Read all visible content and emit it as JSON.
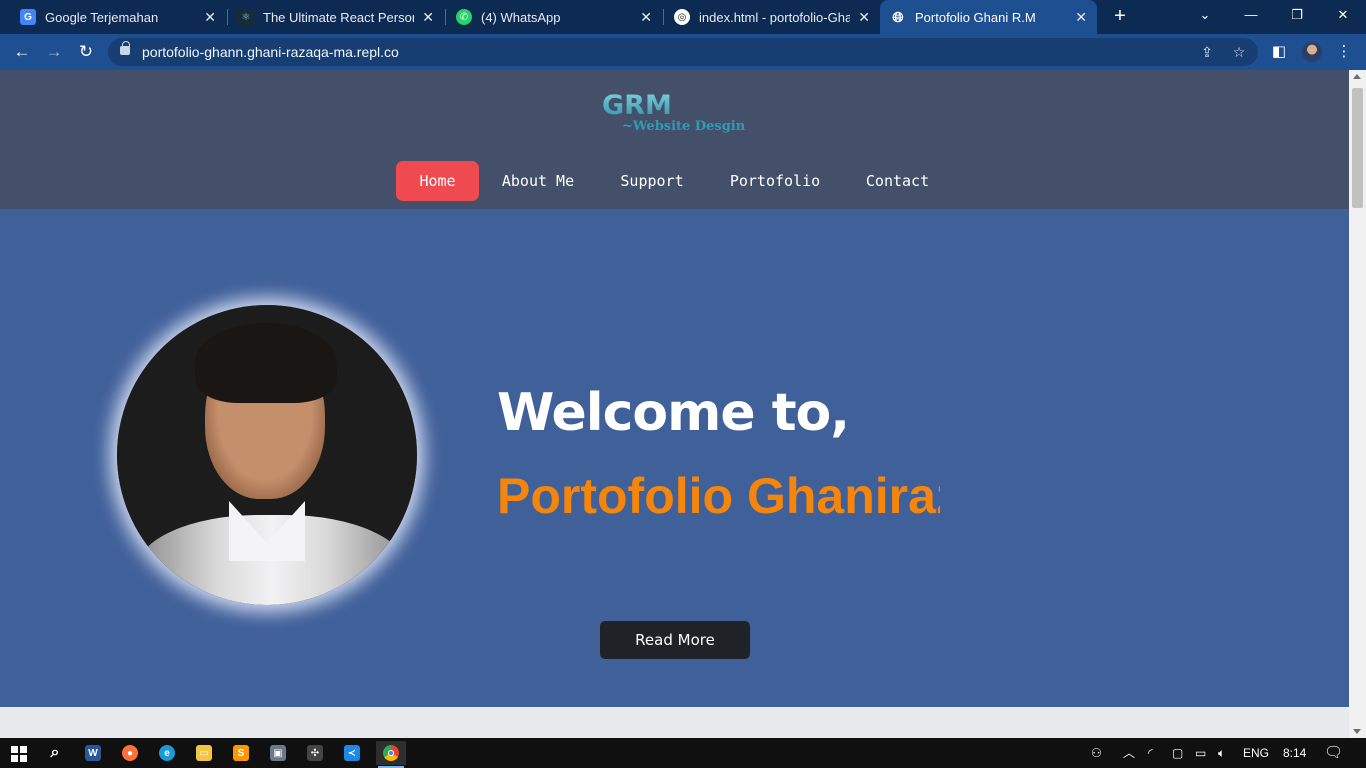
{
  "browser": {
    "tabs": [
      {
        "title": "Google Terjemahan",
        "icon": "google-translate-icon",
        "active": false
      },
      {
        "title": "The Ultimate React Personal P",
        "icon": "react-icon",
        "active": false
      },
      {
        "title": "(4) WhatsApp",
        "icon": "whatsapp-icon",
        "active": false
      },
      {
        "title": "index.html - portofolio-Ghan",
        "icon": "replit-icon",
        "active": false
      },
      {
        "title": "Portofolio Ghani R.M",
        "icon": "globe-icon",
        "active": true
      }
    ],
    "new_tab_icon": "+",
    "url": "portofolio-ghann.ghani-razaqa-ma.repl.co"
  },
  "site": {
    "logo": {
      "text": "GRM",
      "tagline": "~Website Desgin"
    },
    "nav": [
      {
        "label": "Home",
        "active": true
      },
      {
        "label": "About Me",
        "active": false
      },
      {
        "label": "Support",
        "active": false
      },
      {
        "label": "Portofolio",
        "active": false
      },
      {
        "label": "Contact",
        "active": false
      }
    ],
    "hero": {
      "welcome": "Welcome to,",
      "typed_text": "Portofolio Ghaniraz",
      "button": "Read More"
    }
  },
  "colors": {
    "header_bg": "#44506a",
    "hero_bg": "#40609a",
    "nav_active": "#ef4a4f",
    "accent_orange": "#f5860b",
    "button_dark": "#1f2328"
  },
  "taskbar": {
    "apps": [
      "windows-start-icon",
      "search-icon",
      "word-icon",
      "firefox-icon",
      "edge-icon",
      "file-explorer-icon",
      "sublime-text-icon",
      "remote-desktop-icon",
      "network-tool-icon",
      "vscode-icon",
      "chrome-icon"
    ],
    "language": "ENG",
    "time": "8:14"
  }
}
